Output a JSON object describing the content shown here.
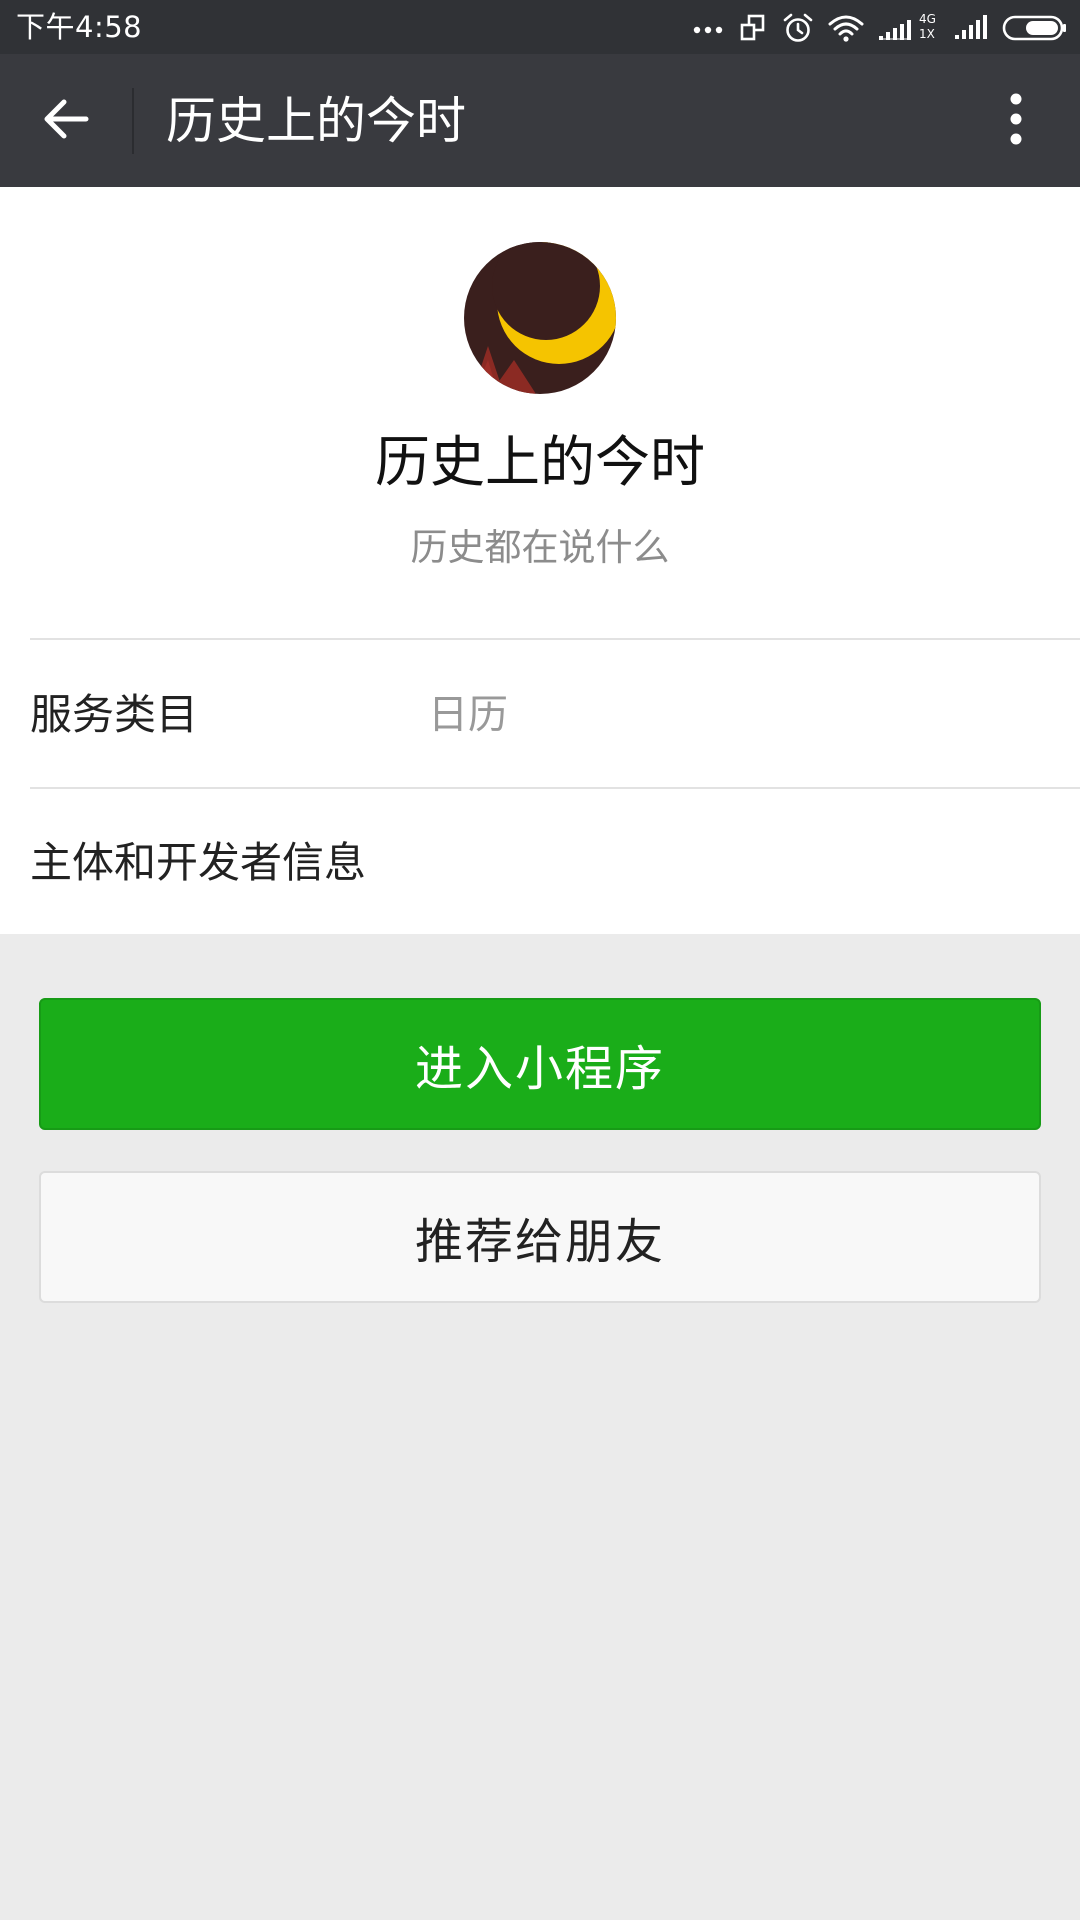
{
  "status_bar": {
    "time": "下午4:58",
    "icons": [
      "more-dots-icon",
      "screen-rotate-icon",
      "alarm-icon",
      "wifi-icon",
      "signal-4g-icon",
      "signal-icon",
      "battery-icon"
    ],
    "network_label_top": "4G",
    "network_label_bottom": "1X"
  },
  "title_bar": {
    "back_icon": "back-arrow-icon",
    "title": "历史上的今时",
    "menu_icon": "more-vertical-icon"
  },
  "profile": {
    "logo_icon": "moon-logo-icon",
    "name": "历史上的今时",
    "description": "历史都在说什么"
  },
  "info_rows": [
    {
      "label": "服务类目",
      "value": "日历"
    },
    {
      "label": "主体和开发者信息",
      "value": ""
    }
  ],
  "actions": {
    "enter_label": "进入小程序",
    "share_label": "推荐给朋友"
  },
  "colors": {
    "status_bar": "#303236",
    "title_bar": "#393a3f",
    "primary_button": "#1aad19",
    "page_background": "#ebebeb",
    "logo_background": "#3a1f1d",
    "logo_moon": "#f5c400",
    "logo_mountain": "#8b2a23"
  }
}
